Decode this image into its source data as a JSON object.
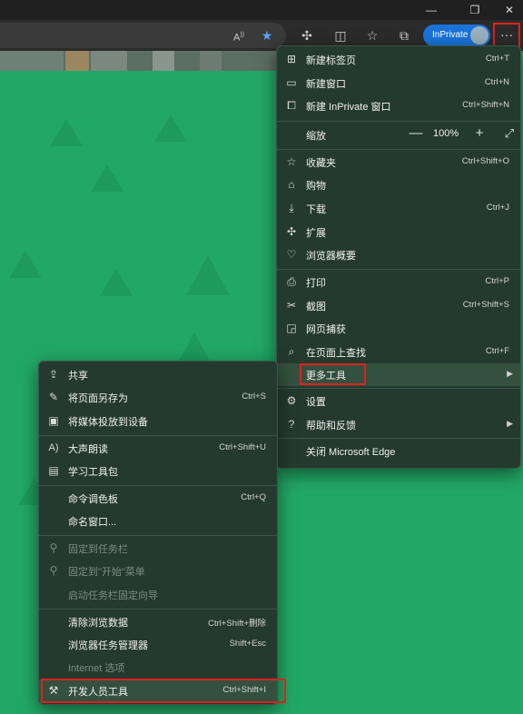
{
  "window": {
    "restore_glyph": "❐",
    "close_glyph": "✕"
  },
  "toolbar": {
    "inprivate_label": "InPrivate",
    "more_glyph": "···"
  },
  "main_menu": {
    "items": [
      {
        "label": "新建标签页",
        "shortcut": "Ctrl+T",
        "icon": "new-tab-icon"
      },
      {
        "label": "新建窗口",
        "shortcut": "Ctrl+N",
        "icon": "new-window-icon"
      },
      {
        "label": "新建 InPrivate 窗口",
        "shortcut": "Ctrl+Shift+N",
        "icon": "inprivate-window-icon"
      },
      {
        "label": "收藏夹",
        "shortcut": "Ctrl+Shift+O",
        "icon": "favorites-icon"
      },
      {
        "label": "购物",
        "shortcut": "",
        "icon": "shopping-tag-icon"
      },
      {
        "label": "下载",
        "shortcut": "Ctrl+J",
        "icon": "download-icon"
      },
      {
        "label": "扩展",
        "shortcut": "",
        "icon": "extensions-icon"
      },
      {
        "label": "浏览器概要",
        "shortcut": "",
        "icon": "browser-essentials-icon"
      },
      {
        "label": "打印",
        "shortcut": "Ctrl+P",
        "icon": "print-icon"
      },
      {
        "label": "截图",
        "shortcut": "Ctrl+Shift+S",
        "icon": "screenshot-icon"
      },
      {
        "label": "网页捕获",
        "shortcut": "",
        "icon": "web-capture-icon"
      },
      {
        "label": "在页面上查找",
        "shortcut": "Ctrl+F",
        "icon": "find-icon"
      },
      {
        "label": "更多工具",
        "shortcut": "",
        "icon": ""
      },
      {
        "label": "设置",
        "shortcut": "",
        "icon": "settings-gear-icon"
      },
      {
        "label": "帮助和反馈",
        "shortcut": "",
        "icon": "help-icon"
      },
      {
        "label": "关闭 Microsoft Edge",
        "shortcut": "",
        "icon": ""
      }
    ],
    "zoom": {
      "label": "缩放",
      "value": "100%",
      "minus": "—",
      "plus": "+"
    }
  },
  "sub_menu": {
    "items": [
      {
        "label": "共享",
        "shortcut": "",
        "icon": "share-icon",
        "disabled": false
      },
      {
        "label": "将页面另存为",
        "shortcut": "Ctrl+S",
        "icon": "save-page-icon",
        "disabled": false
      },
      {
        "label": "将媒体投放到设备",
        "shortcut": "",
        "icon": "cast-media-icon",
        "disabled": false
      },
      {
        "label": "大声朗读",
        "shortcut": "Ctrl+Shift+U",
        "icon": "read-aloud-icon",
        "disabled": false
      },
      {
        "label": "学习工具包",
        "shortcut": "",
        "icon": "learning-toolkit-icon",
        "disabled": false
      },
      {
        "label": "命令调色板",
        "shortcut": "Ctrl+Q",
        "icon": "",
        "disabled": false
      },
      {
        "label": "命名窗口...",
        "shortcut": "",
        "icon": "",
        "disabled": false
      },
      {
        "label": "固定到任务栏",
        "shortcut": "",
        "icon": "pin-icon",
        "disabled": true
      },
      {
        "label": "固定到\"开始\"菜单",
        "shortcut": "",
        "icon": "pin-start-icon",
        "disabled": true
      },
      {
        "label": "启动任务栏固定向导",
        "shortcut": "",
        "icon": "",
        "disabled": true
      },
      {
        "label": "清除浏览数据",
        "shortcut": "Ctrl+Shift+删除",
        "icon": "",
        "disabled": false
      },
      {
        "label": "浏览器任务管理器",
        "shortcut": "Shift+Esc",
        "icon": "",
        "disabled": false
      },
      {
        "label": "Internet 选项",
        "shortcut": "",
        "icon": "",
        "disabled": true
      },
      {
        "label": "开发人员工具",
        "shortcut": "Ctrl+Shift+I",
        "icon": "developer-tools-icon",
        "disabled": false
      }
    ]
  }
}
